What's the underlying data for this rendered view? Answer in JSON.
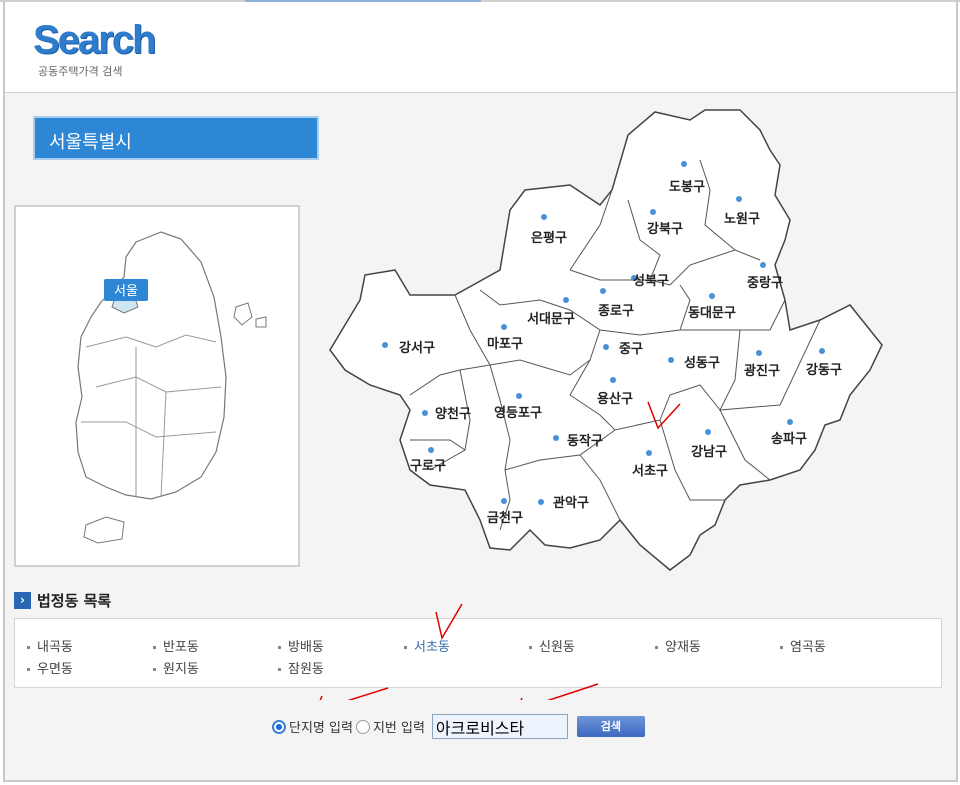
{
  "header": {
    "logo": "Search",
    "subtitle": "공동주택가격 검색"
  },
  "city": "서울특별시",
  "korea_map": {
    "label": "서울"
  },
  "districts": [
    "도봉구",
    "노원구",
    "강북구",
    "은평구",
    "성북구",
    "중랑구",
    "종로구",
    "서대문구",
    "동대문구",
    "강서구",
    "마포구",
    "중구",
    "성동구",
    "광진구",
    "강동구",
    "용산구",
    "양천구",
    "영등포구",
    "동작구",
    "강남구",
    "송파구",
    "서초구",
    "구로구",
    "금천구",
    "관악구"
  ],
  "dong_list": {
    "title": "법정동 목록",
    "items": [
      "내곡동",
      "반포동",
      "방배동",
      "서초동",
      "신원동",
      "양재동",
      "염곡동",
      "우면동",
      "원지동",
      "잠원동"
    ],
    "selected": "서초동"
  },
  "search": {
    "radio_options": [
      "단지명 입력",
      "지번 입력"
    ],
    "selected_option": "단지명 입력",
    "input_value": "아크로비스타",
    "button": "검색"
  },
  "colors": {
    "accent": "#2e87d4",
    "dot": "#4a90d9",
    "annotation": "#e00000"
  }
}
